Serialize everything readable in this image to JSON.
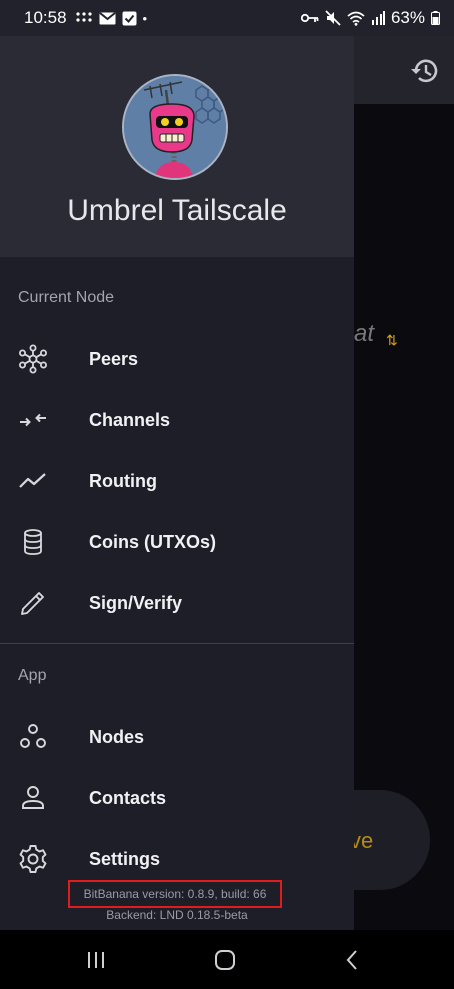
{
  "status_bar": {
    "time": "10:58",
    "battery": "63%"
  },
  "drawer": {
    "node_name": "Umbrel Tailscale",
    "current_node_section": "Current Node",
    "current_node_items": [
      {
        "label": "Peers",
        "icon": "peers-icon"
      },
      {
        "label": "Channels",
        "icon": "channels-icon"
      },
      {
        "label": "Routing",
        "icon": "routing-icon"
      },
      {
        "label": "Coins (UTXOs)",
        "icon": "coins-icon"
      },
      {
        "label": "Sign/Verify",
        "icon": "sign-verify-icon"
      }
    ],
    "app_section": "App",
    "app_items": [
      {
        "label": "Nodes",
        "icon": "nodes-icon"
      },
      {
        "label": "Contacts",
        "icon": "contacts-icon"
      },
      {
        "label": "Settings",
        "icon": "settings-icon"
      }
    ],
    "version_text": "BitBanana version:  0.8.9, build: 66",
    "backend_text": "Backend: LND 0.18.5-beta"
  },
  "background": {
    "partial_text": "at",
    "partial_button_text": "ve"
  },
  "colors": {
    "drawer_bg": "#1d1e27",
    "header_bg": "#2a2b35",
    "accent": "#d4a010",
    "highlight_box": "#e11c1c"
  }
}
